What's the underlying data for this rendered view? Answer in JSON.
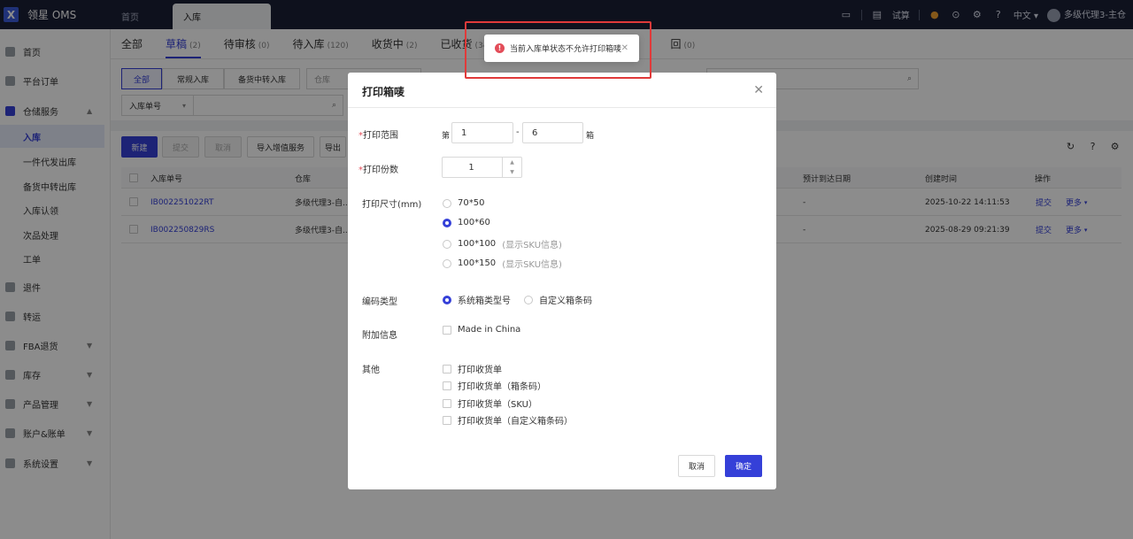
{
  "app": {
    "name": "领星 OMS",
    "logo_letter": "X"
  },
  "tabs": {
    "home": "首页",
    "active": "入库"
  },
  "topbar": {
    "trial": "试算",
    "lang": "中文",
    "user": "多级代理3-主仓"
  },
  "sidebar": {
    "items": [
      {
        "label": "首页"
      },
      {
        "label": "平台订单"
      },
      {
        "label": "仓储服务"
      },
      {
        "label": "退件"
      },
      {
        "label": "转运"
      },
      {
        "label": "FBA退货"
      },
      {
        "label": "库存"
      },
      {
        "label": "产品管理"
      },
      {
        "label": "账户&账单"
      },
      {
        "label": "系统设置"
      }
    ],
    "sub_items": [
      {
        "label": "入库"
      },
      {
        "label": "一件代发出库"
      },
      {
        "label": "备货中转出库"
      },
      {
        "label": "入库认领"
      },
      {
        "label": "次品处理"
      },
      {
        "label": "工单"
      }
    ]
  },
  "status_tabs": [
    {
      "label": "全部",
      "count": ""
    },
    {
      "label": "草稿",
      "count": "(2)"
    },
    {
      "label": "待审核",
      "count": "(0)"
    },
    {
      "label": "待入库",
      "count": "(120)"
    },
    {
      "label": "收货中",
      "count": "(2)"
    },
    {
      "label": "已收货",
      "count": "(34"
    },
    {
      "label": "回",
      "count": "(0)"
    }
  ],
  "filters": {
    "type_all": "全部",
    "type_normal": "常规入库",
    "type_transfer": "备货中转入库",
    "warehouse_placeholder": "仓库",
    "search_field": "入库单号"
  },
  "toolbar": {
    "new": "新建",
    "submit": "提交",
    "cancel": "取消",
    "import_value_added": "导入增值服务",
    "export": "导出"
  },
  "table": {
    "headers": {
      "order_no": "入库单号",
      "warehouse": "仓库",
      "eta": "预计到达日期",
      "created": "创建时间",
      "actions": "操作"
    },
    "rows": [
      {
        "order_no": "IB002251022RT",
        "warehouse": "多级代理3-自...",
        "eta": "-",
        "created": "2025-10-22 14:11:53",
        "submit": "提交",
        "more": "更多"
      },
      {
        "order_no": "IB002250829RS",
        "warehouse": "多级代理3-自...",
        "eta": "-",
        "created": "2025-08-29 09:21:39",
        "submit": "提交",
        "more": "更多"
      }
    ]
  },
  "modal": {
    "title": "打印箱唛",
    "range_label": "打印范围",
    "range_prefix": "第",
    "range_from": "1",
    "range_dash": "-",
    "range_to": "6",
    "range_suffix": "箱",
    "copies_label": "打印份数",
    "copies_value": "1",
    "size_label": "打印尺寸(mm)",
    "size_options": [
      {
        "label": "70*50",
        "sub": ""
      },
      {
        "label": "100*60",
        "sub": ""
      },
      {
        "label": "100*100",
        "sub": "(显示SKU信息)"
      },
      {
        "label": "100*150",
        "sub": "(显示SKU信息)"
      }
    ],
    "size_selected": "100*60",
    "code_label": "编码类型",
    "code_options": [
      {
        "label": "系统箱类型号"
      },
      {
        "label": "自定义箱条码"
      }
    ],
    "code_selected": "系统箱类型号",
    "extra_label": "附加信息",
    "extra_option": "Made in China",
    "other_label": "其他",
    "other_options": [
      {
        "label": "打印收货单"
      },
      {
        "label": "打印收货单（箱条码）"
      },
      {
        "label": "打印收货单（SKU）"
      },
      {
        "label": "打印收货单（自定义箱条码）"
      }
    ],
    "cancel": "取消",
    "confirm": "确定"
  },
  "toast": {
    "message": "当前入库单状态不允许打印箱唛",
    "error_glyph": "!"
  },
  "colors": {
    "primary": "#3540d8",
    "topbar": "#1a1f36",
    "error": "#e34d59"
  }
}
